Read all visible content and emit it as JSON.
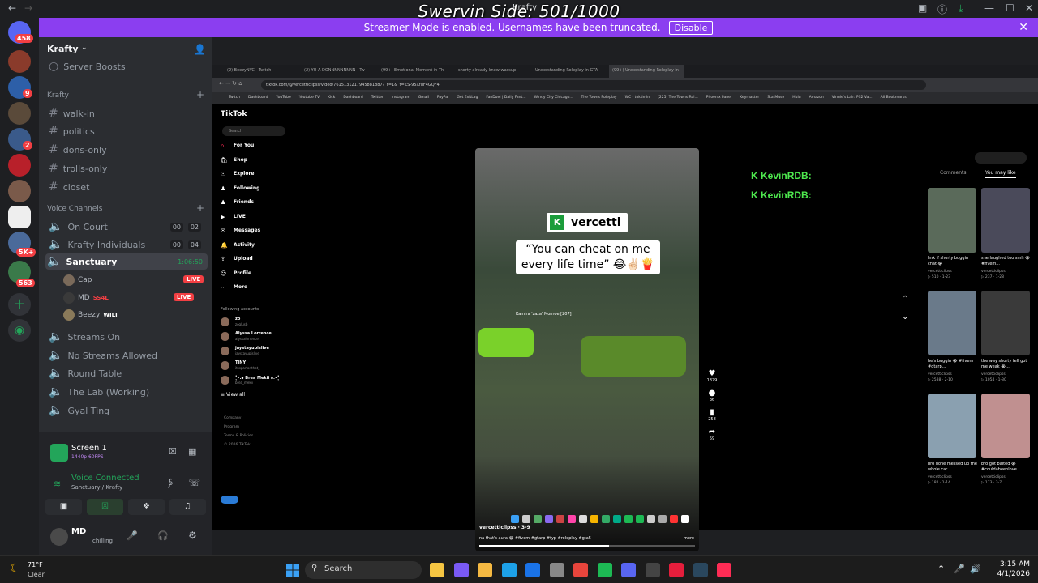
{
  "overlay": {
    "text": "Swervin Side: 501/1000",
    "app_title": "Krafty"
  },
  "banner": {
    "message": "Streamer Mode is enabled. Usernames have been truncated.",
    "disable": "Disable"
  },
  "servers": {
    "badges": [
      "458",
      "9",
      "2",
      "5K+",
      "563"
    ]
  },
  "sidebar": {
    "server_name": "Krafty",
    "server_boosts": "Server Boosts",
    "category": "Krafty",
    "text_channels": [
      "walk-in",
      "politics",
      "dons-only",
      "trolls-only",
      "closet"
    ],
    "voice_category": "Voice Channels",
    "voice_channels": [
      {
        "name": "On Court",
        "c1": "00",
        "c2": "02"
      },
      {
        "name": "Krafty Individuals",
        "c1": "00",
        "c2": "04"
      },
      {
        "name": "Sanctuary",
        "timer": "1:06:50"
      }
    ],
    "sanctuary_users": [
      {
        "name": "Cap",
        "live": "LIVE"
      },
      {
        "name": "MD",
        "extra": "SS4L",
        "live": "LIVE"
      },
      {
        "name": "Beezy",
        "extra": "WILT"
      }
    ],
    "more_channels": [
      "Streams On",
      "No Streams Allowed",
      "Round Table",
      "The Lab (Working)",
      "Gyal Ting"
    ]
  },
  "user_area": {
    "screen": "Screen 1",
    "screen_sub": "1440p 60FPS",
    "voice": "Voice Connected",
    "voice_sub": "Sanctuary / Krafty",
    "user": "MD",
    "status": "chilling"
  },
  "browser": {
    "tabs": [
      "(2) BeezyNYC - Twitch",
      "(2) YU A DONNNNNNNNN - Tw",
      "(99+) Emotional Moment in Th",
      "shorty already knew wassup",
      "Understanding Roleplay in GTA",
      "(99+) Understanding Roleplay in"
    ],
    "url": "tiktok.com/@vercetticlipss/video/7615131217945881887?_r=1&_t=ZS-95XfuF4GQF4",
    "bookmarks": [
      "Twitch",
      "Dashboard",
      "YouTube",
      "Youtube TV",
      "Kick",
      "Dashboard",
      "Twitter",
      "Instagram",
      "Gmail",
      "PayPal",
      "Get ExitLag",
      "FanDuel | Daily Fant...",
      "Windy City Chicago...",
      "The Towns Roleplay",
      "WC - tokdmin",
      "(225) The Towns Rol...",
      "Phoenix Panel",
      "Keymaster",
      "StatMuse",
      "Hulu",
      "Amazon",
      "Vinnie's Lair: PS2 Va...",
      "All Bookmarks"
    ]
  },
  "tiktok": {
    "logo": "TikTok",
    "search": "Search",
    "nav": [
      "For You",
      "Shop",
      "Explore",
      "Following",
      "Friends",
      "LIVE",
      "Messages",
      "Activity",
      "Upload",
      "Profile",
      "More"
    ],
    "following_title": "Following accounts",
    "following": [
      {
        "name": "zo",
        "sub": "zoglusb"
      },
      {
        "name": "Alyssa Lorrence",
        "sub": "alyssalorrence"
      },
      {
        "name": "jaystayupislive",
        "sub": "jaystayupislive"
      },
      {
        "name": "TINY",
        "sub": "itsspartanthat_"
      },
      {
        "name": "˚̥̇•․๑ Brea Mekii ๑․•˚̥̇",
        "sub": "brea_mekii"
      }
    ],
    "view_all": "View all",
    "footer": [
      "Company",
      "Program",
      "Terms & Policies",
      "© 2026 TikTok"
    ],
    "video": {
      "brand": "vercetti",
      "caption": "“You can cheat on me every life time” 😂✌🏻🍟",
      "ingame": "Kamira 'zaza' Monroe [207]",
      "author": "vercetticlipss · 3-9",
      "desc": "na that's aura 😭 #fivem #gtarp #fyp #roleplay #gta5",
      "more": "more"
    },
    "actions": [
      "1879",
      "36",
      "258",
      "59"
    ],
    "kevin": [
      "KevinRDB:",
      "KevinRDB:"
    ],
    "panel_tabs": [
      "Comments",
      "You may like"
    ],
    "cards": [
      {
        "cap": "lmk if shorty buggin chat 😭",
        "author": "vercetticlipss",
        "stats": "▷ 510 · 1-23"
      },
      {
        "cap": "she laughed too smh 😭 #fivem...",
        "author": "vercetticlipss",
        "stats": "▷ 237 · 1-28"
      },
      {
        "cap": "he's buggin 😭 #fivem #gtarp...",
        "author": "vercetticlipss",
        "stats": "▷ 2588 · 2-10"
      },
      {
        "cap": "the way shorty fell got me weak 😭...",
        "author": "vercetticlipss",
        "stats": "▷ 1054 · 1-30"
      },
      {
        "cap": "bro done messed up the whole car...",
        "author": "vercetticlipss",
        "stats": "▷ 182 · 1-14"
      },
      {
        "cap": "bro got baited 😭 #couldabeenlove...",
        "author": "vercetticlipss",
        "stats": "▷ 173 · 3-7"
      }
    ]
  },
  "taskbar": {
    "weather": "71°F",
    "weather_sub": "Clear",
    "search": "Search",
    "time": "3:15 AM",
    "date": "4/1/2026"
  }
}
